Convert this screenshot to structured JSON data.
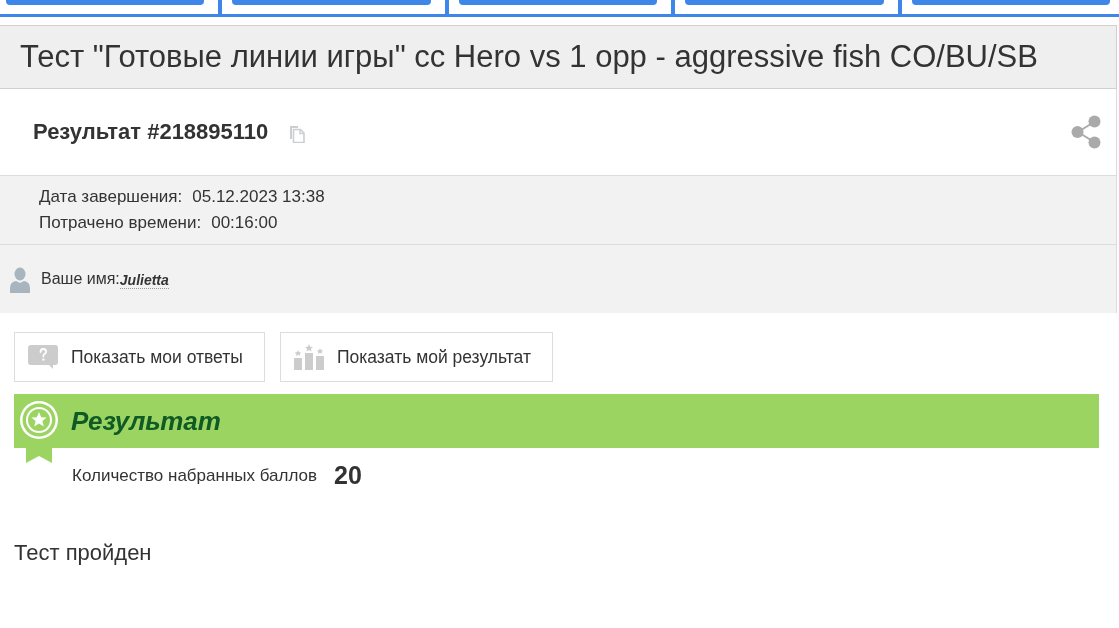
{
  "test_title": "Тест \"Готовые линии игры\" сс Hero vs 1 opp - aggressive fish CO/BU/SB",
  "result": {
    "title": "Результат #218895110"
  },
  "details": [
    {
      "label": "Дата завершения:",
      "value": "05.12.2023 13:38"
    },
    {
      "label": "Потрачено времени:",
      "value": "00:16:00"
    }
  ],
  "user": {
    "label": "Ваше имя:",
    "name": "Julietta"
  },
  "buttons": [
    {
      "label": "Показать мои ответы",
      "kind": "answers"
    },
    {
      "label": "Показать мой результат",
      "kind": "podium"
    }
  ],
  "score_panel": {
    "heading": "Результат",
    "score_label": "Количество набранных баллов",
    "score": "20"
  },
  "status": "Тест пройден"
}
